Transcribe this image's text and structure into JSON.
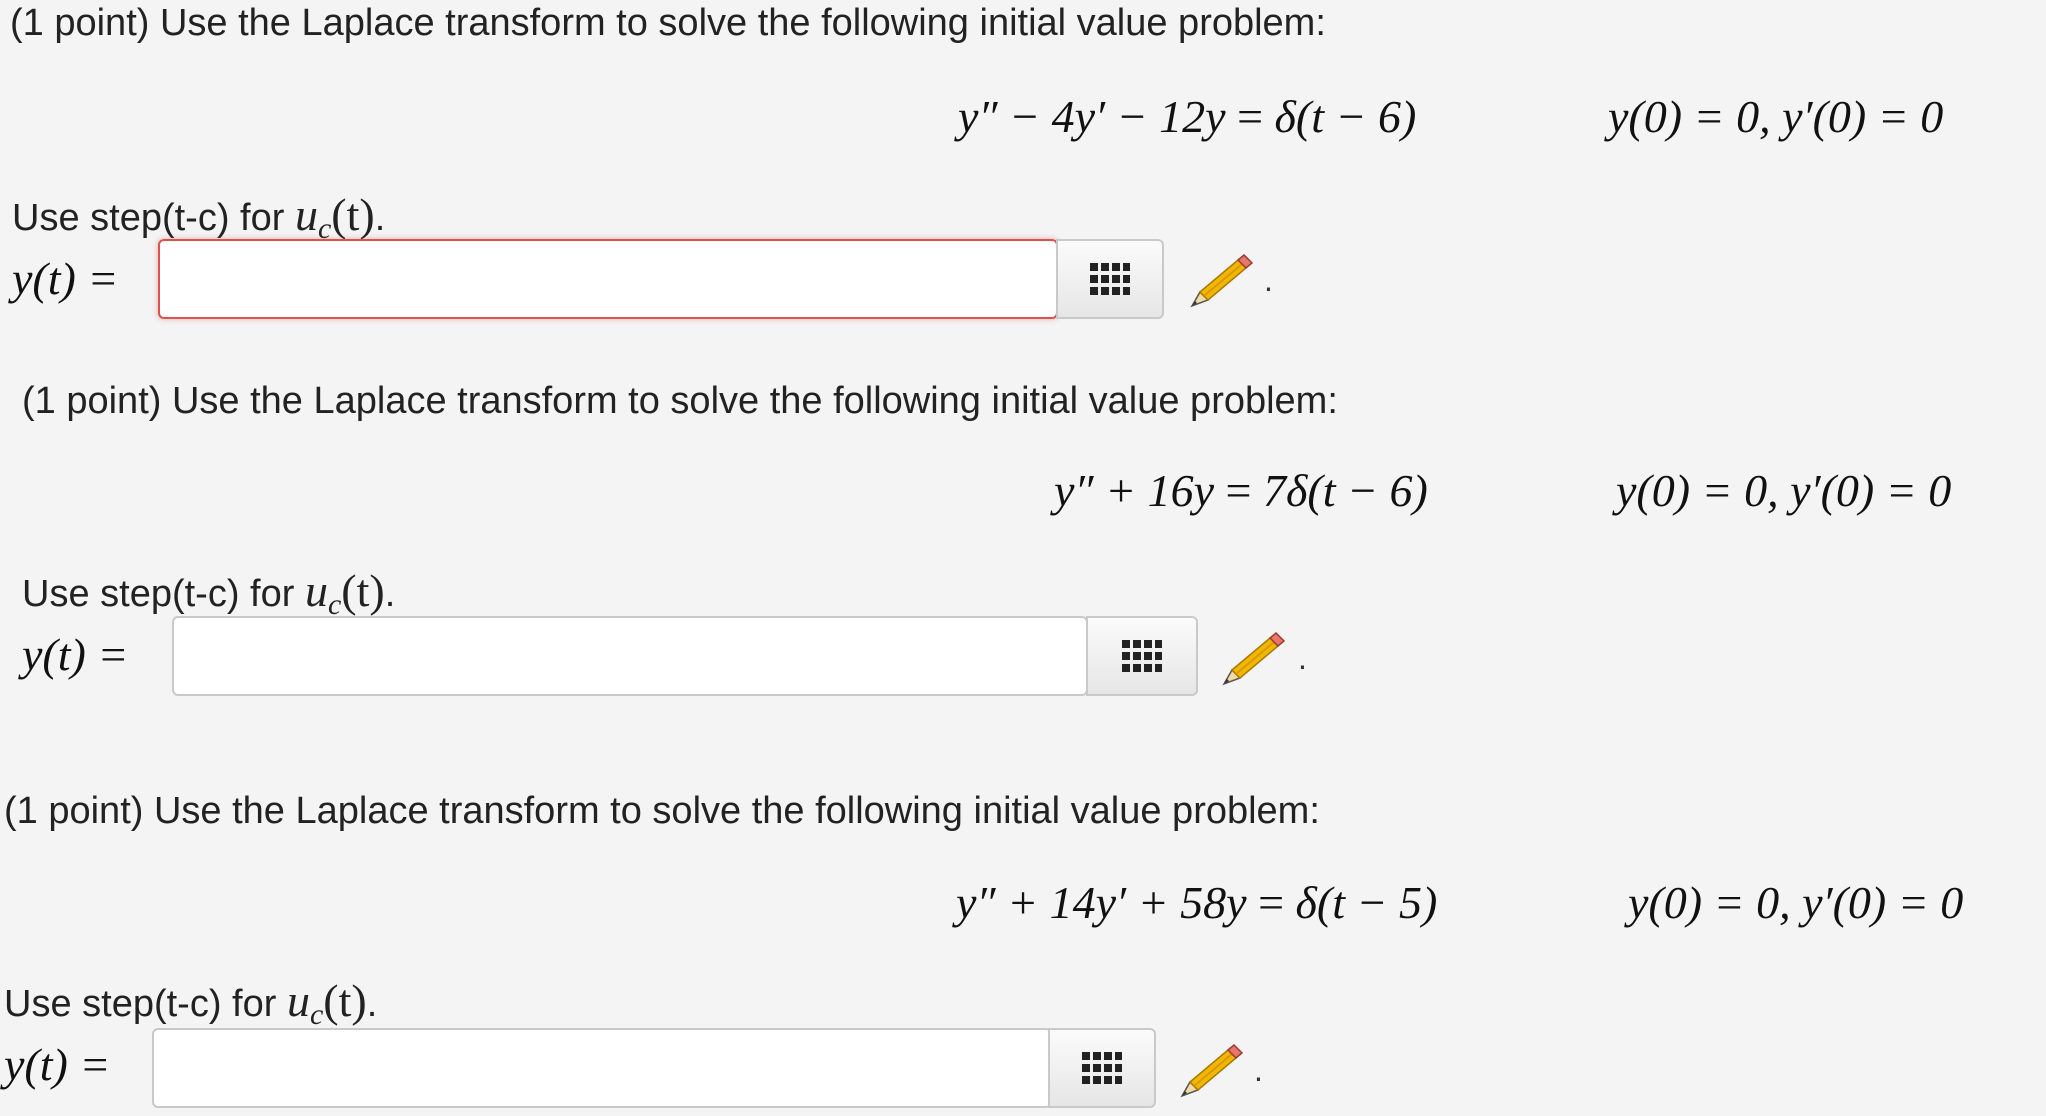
{
  "problems": [
    {
      "intro": "(1 point) Use the Laplace transform to solve the following initial value problem:",
      "equation": {
        "lhs": "y″ − 4y′ − 12y",
        "eq": "=",
        "rhs": "δ(t − 6)"
      },
      "initial_conditions": "y(0) = 0,  y′(0) = 0",
      "hint_prefix": "Use step(t-c) for ",
      "hint_math_base": "u",
      "hint_math_sub": "c",
      "hint_math_arg": "(t)",
      "hint_suffix": ".",
      "answer_label": "y(t) =",
      "answer_value": "",
      "answer_state": "error",
      "trailing_dot": "."
    },
    {
      "intro": "(1 point) Use the Laplace transform to solve the following initial value problem:",
      "equation": {
        "lhs": "y″ + 16y",
        "eq": "=",
        "rhs": "7δ(t − 6)"
      },
      "initial_conditions": "y(0) = 0,  y′(0) = 0",
      "hint_prefix": "Use step(t-c) for ",
      "hint_math_base": "u",
      "hint_math_sub": "c",
      "hint_math_arg": "(t)",
      "hint_suffix": ".",
      "answer_label": "y(t) =",
      "answer_value": "",
      "answer_state": "normal",
      "trailing_dot": "."
    },
    {
      "intro": "(1 point) Use the Laplace transform to solve the following initial value problem:",
      "equation": {
        "lhs": "y″ + 14y′ + 58y",
        "eq": "=",
        "rhs": "δ(t − 5)"
      },
      "initial_conditions": "y(0) = 0,  y′(0) = 0",
      "hint_prefix": "Use step(t-c) for ",
      "hint_math_base": "u",
      "hint_math_sub": "c",
      "hint_math_arg": "(t)",
      "hint_suffix": ".",
      "answer_label": "y(t) =",
      "answer_value": "",
      "answer_state": "normal",
      "trailing_dot": "."
    }
  ],
  "icons": {
    "grid_button": "grid-icon",
    "editor_button": "pencil-icon"
  },
  "colors": {
    "background": "#f4f4f4",
    "error_border": "#d9534f",
    "input_border": "#c9c9c9",
    "pencil_yellow": "#f2b705"
  }
}
